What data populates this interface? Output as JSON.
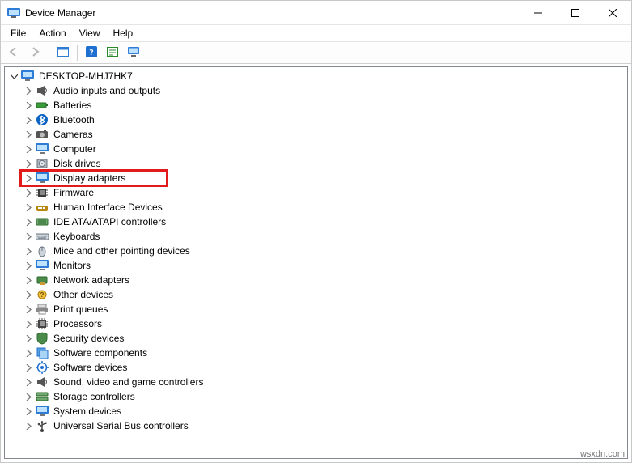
{
  "window": {
    "title": "Device Manager"
  },
  "menu": {
    "file": "File",
    "action": "Action",
    "view": "View",
    "help": "Help"
  },
  "toolbar": {
    "back": "back",
    "forward": "forward",
    "show_hidden": "show-hidden",
    "help": "help",
    "properties": "properties",
    "monitor": "monitor"
  },
  "tree": {
    "root": {
      "label": "DESKTOP-MHJ7HK7",
      "expanded": true
    },
    "children": [
      {
        "id": "audio",
        "label": "Audio inputs and outputs",
        "icon": "speaker"
      },
      {
        "id": "batteries",
        "label": "Batteries",
        "icon": "battery"
      },
      {
        "id": "bluetooth",
        "label": "Bluetooth",
        "icon": "bluetooth"
      },
      {
        "id": "cameras",
        "label": "Cameras",
        "icon": "camera"
      },
      {
        "id": "computer",
        "label": "Computer",
        "icon": "monitor"
      },
      {
        "id": "disk",
        "label": "Disk drives",
        "icon": "disk"
      },
      {
        "id": "display",
        "label": "Display adapters",
        "icon": "monitor",
        "highlight": true
      },
      {
        "id": "firmware",
        "label": "Firmware",
        "icon": "chip"
      },
      {
        "id": "hid",
        "label": "Human Interface Devices",
        "icon": "hid"
      },
      {
        "id": "ide",
        "label": "IDE ATA/ATAPI controllers",
        "icon": "ide"
      },
      {
        "id": "keyboards",
        "label": "Keyboards",
        "icon": "keyboard"
      },
      {
        "id": "mice",
        "label": "Mice and other pointing devices",
        "icon": "mouse"
      },
      {
        "id": "monitors",
        "label": "Monitors",
        "icon": "monitor"
      },
      {
        "id": "network",
        "label": "Network adapters",
        "icon": "network"
      },
      {
        "id": "other",
        "label": "Other devices",
        "icon": "other"
      },
      {
        "id": "printq",
        "label": "Print queues",
        "icon": "printer"
      },
      {
        "id": "processors",
        "label": "Processors",
        "icon": "cpu"
      },
      {
        "id": "security",
        "label": "Security devices",
        "icon": "security"
      },
      {
        "id": "softcomp",
        "label": "Software components",
        "icon": "softcomp"
      },
      {
        "id": "softdev",
        "label": "Software devices",
        "icon": "softdev"
      },
      {
        "id": "sound",
        "label": "Sound, video and game controllers",
        "icon": "sound"
      },
      {
        "id": "storage",
        "label": "Storage controllers",
        "icon": "storage"
      },
      {
        "id": "system",
        "label": "System devices",
        "icon": "system"
      },
      {
        "id": "usb",
        "label": "Universal Serial Bus controllers",
        "icon": "usb"
      }
    ]
  },
  "watermark": "wsxdn.com"
}
